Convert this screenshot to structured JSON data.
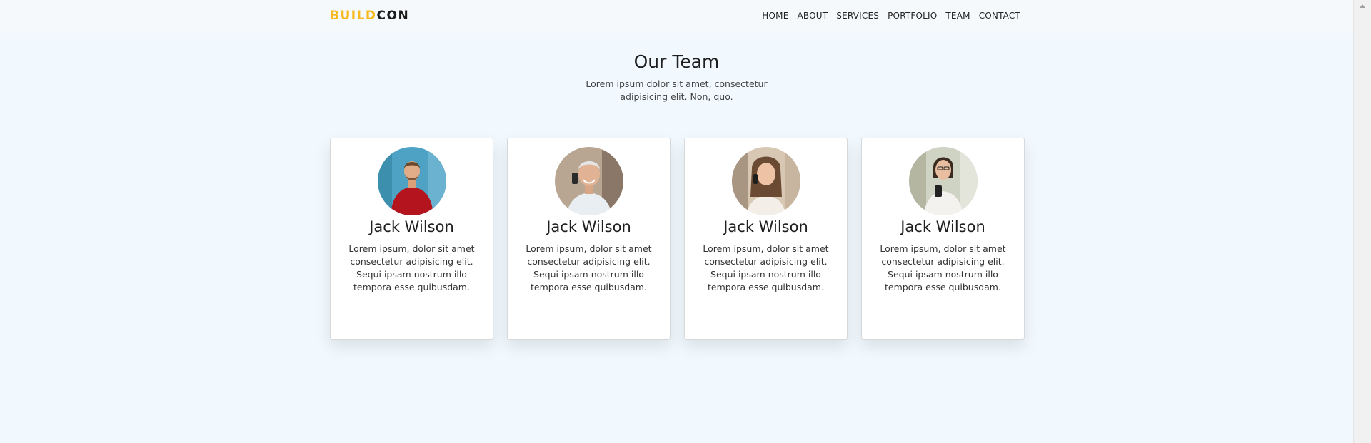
{
  "brand": {
    "part1": "BUILD",
    "part2": "CON"
  },
  "nav": {
    "items": [
      "HOME",
      "ABOUT",
      "SERVICES",
      "PORTFOLIO",
      "TEAM",
      "CONTACT"
    ]
  },
  "team": {
    "title": "Our Team",
    "subtitle_line1": "Lorem ipsum dolor sit amet, consectetur",
    "subtitle_line2": "adipisicing elit. Non, quo.",
    "members": [
      {
        "name": "Jack Wilson",
        "bio": "Lorem ipsum, dolor sit amet consectetur adipisicing elit. Sequi ipsam nostrum illo tempora esse quibusdam.",
        "photo": "man-red-shirt-photo"
      },
      {
        "name": "Jack Wilson",
        "bio": "Lorem ipsum, dolor sit amet consectetur adipisicing elit. Sequi ipsam nostrum illo tempora esse quibusdam.",
        "photo": "older-man-phone-photo"
      },
      {
        "name": "Jack Wilson",
        "bio": "Lorem ipsum, dolor sit amet consectetur adipisicing elit. Sequi ipsam nostrum illo tempora esse quibusdam.",
        "photo": "woman-phone-photo"
      },
      {
        "name": "Jack Wilson",
        "bio": "Lorem ipsum, dolor sit amet consectetur adipisicing elit. Sequi ipsam nostrum illo tempora esse quibusdam.",
        "photo": "woman-smartphone-photo"
      }
    ]
  },
  "colors": {
    "brand_accent": "#f6b91f",
    "page_bg": "#f1f9fe",
    "nav_bg": "#f6f9fb"
  }
}
